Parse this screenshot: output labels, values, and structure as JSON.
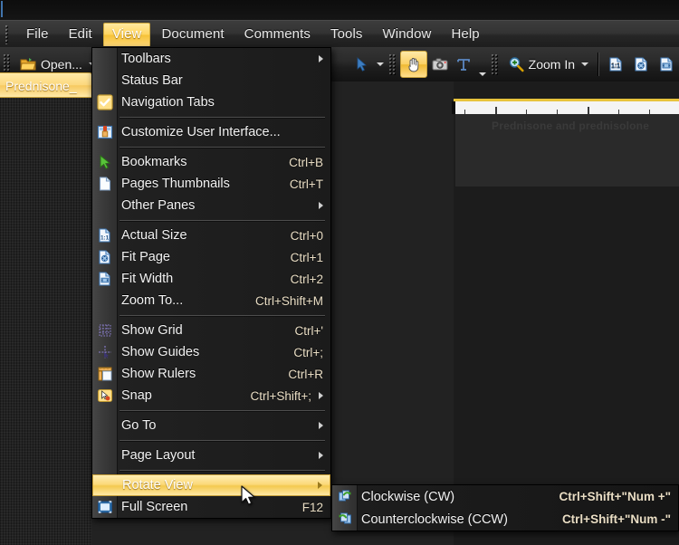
{
  "app": {
    "accent_gold": "#f5c238",
    "chrome_dark": "#232323",
    "menu_bg": "#1e1e1e"
  },
  "menubar": {
    "items": [
      {
        "label": "File",
        "active": false
      },
      {
        "label": "Edit",
        "active": false
      },
      {
        "label": "View",
        "active": true
      },
      {
        "label": "Document",
        "active": false
      },
      {
        "label": "Comments",
        "active": false
      },
      {
        "label": "Tools",
        "active": false
      },
      {
        "label": "Window",
        "active": false
      },
      {
        "label": "Help",
        "active": false
      }
    ]
  },
  "toolbar": {
    "open_label": "Open...",
    "open_icon": "folder-open-icon",
    "zoom_in_label": "Zoom In",
    "zoom_in_icon": "magnifier-plus-icon",
    "hand_tool_icon": "hand-tool-icon",
    "snapshot_icon": "camera-snapshot-icon",
    "text_select_icon": "text-select-icon",
    "select_tool_icon": "select-arrow-icon",
    "actual_size_icon": "actual-size-icon",
    "fit_page_icon": "fit-page-icon",
    "fit_width_icon": "fit-width-icon"
  },
  "document_tab": {
    "label": "Prednisone_"
  },
  "viewport": {
    "page_heading": "Prednisone and prednisolone"
  },
  "view_menu": {
    "items": [
      {
        "kind": "item",
        "label": "Toolbars",
        "accel": "",
        "icon": "",
        "submenu": true,
        "checked": false,
        "highlighted": false
      },
      {
        "kind": "item",
        "label": "Status Bar",
        "accel": "",
        "icon": "",
        "submenu": false,
        "checked": false,
        "highlighted": false
      },
      {
        "kind": "item",
        "label": "Navigation Tabs",
        "accel": "",
        "icon": "check-icon",
        "submenu": false,
        "checked": true,
        "highlighted": false
      },
      {
        "kind": "sep"
      },
      {
        "kind": "item",
        "label": "Customize User Interface...",
        "accel": "",
        "icon": "customize-ui-icon",
        "submenu": false,
        "checked": false,
        "highlighted": false
      },
      {
        "kind": "sep"
      },
      {
        "kind": "item",
        "label": "Bookmarks",
        "accel": "Ctrl+B",
        "icon": "bookmark-arrow-icon",
        "submenu": false,
        "checked": false,
        "highlighted": false
      },
      {
        "kind": "item",
        "label": "Pages Thumbnails",
        "accel": "Ctrl+T",
        "icon": "page-thumbnail-icon",
        "submenu": false,
        "checked": false,
        "highlighted": false
      },
      {
        "kind": "item",
        "label": "Other Panes",
        "accel": "",
        "icon": "",
        "submenu": true,
        "checked": false,
        "highlighted": false
      },
      {
        "kind": "sep"
      },
      {
        "kind": "item",
        "label": "Actual Size",
        "accel": "Ctrl+0",
        "icon": "actual-size-icon",
        "submenu": false,
        "checked": false,
        "highlighted": false
      },
      {
        "kind": "item",
        "label": "Fit Page",
        "accel": "Ctrl+1",
        "icon": "fit-page-icon",
        "submenu": false,
        "checked": false,
        "highlighted": false
      },
      {
        "kind": "item",
        "label": "Fit Width",
        "accel": "Ctrl+2",
        "icon": "fit-width-icon",
        "submenu": false,
        "checked": false,
        "highlighted": false
      },
      {
        "kind": "item",
        "label": "Zoom To...",
        "accel": "Ctrl+Shift+M",
        "icon": "",
        "submenu": false,
        "checked": false,
        "highlighted": false
      },
      {
        "kind": "sep"
      },
      {
        "kind": "item",
        "label": "Show Grid",
        "accel": "Ctrl+'",
        "icon": "grid-icon",
        "submenu": false,
        "checked": false,
        "highlighted": false
      },
      {
        "kind": "item",
        "label": "Show Guides",
        "accel": "Ctrl+;",
        "icon": "guides-icon",
        "submenu": false,
        "checked": false,
        "highlighted": false
      },
      {
        "kind": "item",
        "label": "Show Rulers",
        "accel": "Ctrl+R",
        "icon": "ruler-icon",
        "submenu": false,
        "checked": false,
        "highlighted": false
      },
      {
        "kind": "item",
        "label": "Snap",
        "accel": "Ctrl+Shift+;",
        "icon": "snap-icon",
        "submenu": true,
        "checked": false,
        "highlighted": false
      },
      {
        "kind": "sep"
      },
      {
        "kind": "item",
        "label": "Go To",
        "accel": "",
        "icon": "",
        "submenu": true,
        "checked": false,
        "highlighted": false
      },
      {
        "kind": "sep"
      },
      {
        "kind": "item",
        "label": "Page Layout",
        "accel": "",
        "icon": "",
        "submenu": true,
        "checked": false,
        "highlighted": false
      },
      {
        "kind": "sep"
      },
      {
        "kind": "item",
        "label": "Rotate View",
        "accel": "",
        "icon": "",
        "submenu": true,
        "checked": false,
        "highlighted": true
      },
      {
        "kind": "item",
        "label": "Full Screen",
        "accel": "F12",
        "icon": "full-screen-icon",
        "submenu": false,
        "checked": false,
        "highlighted": false
      }
    ]
  },
  "rotate_submenu": {
    "items": [
      {
        "label": "Clockwise (CW)",
        "accel": "Ctrl+Shift+\"Num +\"",
        "icon": "rotate-cw-icon"
      },
      {
        "label": "Counterclockwise (CCW)",
        "accel": "Ctrl+Shift+\"Num -\"",
        "icon": "rotate-ccw-icon"
      }
    ]
  },
  "cursor": {
    "icon": "mouse-pointer-icon"
  }
}
